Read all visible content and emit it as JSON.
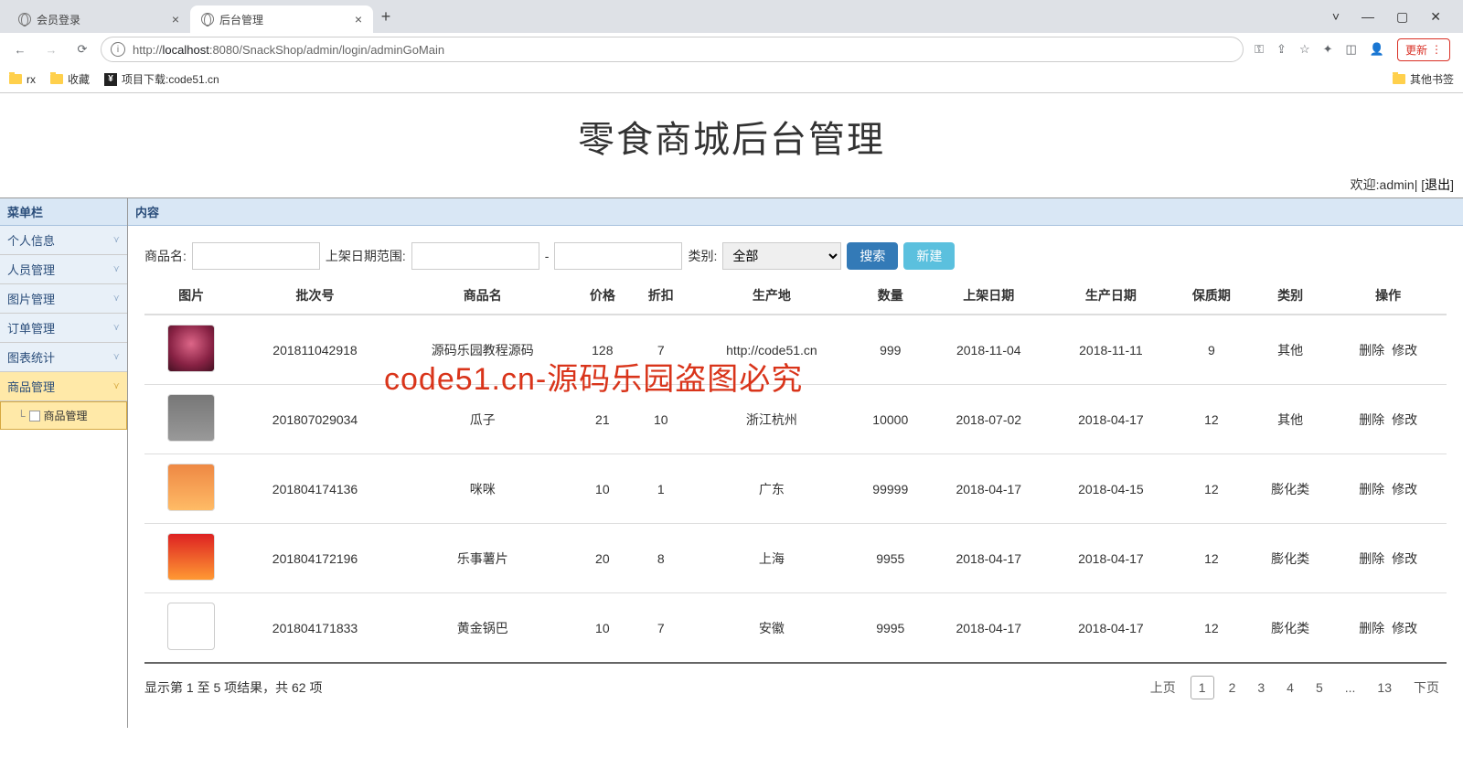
{
  "browser": {
    "tabs": [
      {
        "title": "会员登录",
        "active": false
      },
      {
        "title": "后台管理",
        "active": true
      }
    ],
    "window_controls": {
      "minimize": "—",
      "maximize": "▢",
      "close": "✕"
    },
    "url_host": "localhost",
    "url_prefix": "http://",
    "url_port_path": ":8080/SnackShop/admin/login/adminGoMain",
    "update_label": "更新",
    "bookmarks": [
      {
        "label": "rx",
        "type": "folder"
      },
      {
        "label": "收藏",
        "type": "folder"
      },
      {
        "label": "项目下载:code51.cn",
        "type": "link"
      }
    ],
    "other_bookmarks": "其他书签"
  },
  "header": {
    "title": "零食商城后台管理",
    "welcome_prefix": "欢迎:",
    "username": "admin",
    "logout_label": "退出"
  },
  "sidebar": {
    "title": "菜单栏",
    "items": [
      {
        "label": "个人信息"
      },
      {
        "label": "人员管理"
      },
      {
        "label": "图片管理"
      },
      {
        "label": "订单管理"
      },
      {
        "label": "图表统计"
      },
      {
        "label": "商品管理",
        "active": true,
        "submenu": [
          {
            "label": "商品管理"
          }
        ]
      }
    ]
  },
  "content": {
    "panel_title": "内容",
    "filters": {
      "name_label": "商品名:",
      "date_range_label": "上架日期范围:",
      "range_sep": "-",
      "category_label": "类别:",
      "category_value": "全部",
      "search_label": "搜索",
      "create_label": "新建"
    },
    "columns": [
      "图片",
      "批次号",
      "商品名",
      "价格",
      "折扣",
      "生产地",
      "数量",
      "上架日期",
      "生产日期",
      "保质期",
      "类别",
      "操作"
    ],
    "rows": [
      {
        "thumb": "t1",
        "batch": "201811042918",
        "name": "源码乐园教程源码",
        "price": "128",
        "discount": "7",
        "origin": "http://code51.cn",
        "qty": "999",
        "list_date": "2018-11-04",
        "prod_date": "2018-11-11",
        "shelf": "9",
        "cat": "其他"
      },
      {
        "thumb": "t2",
        "batch": "201807029034",
        "name": "瓜子",
        "price": "21",
        "discount": "10",
        "origin": "浙江杭州",
        "qty": "10000",
        "list_date": "2018-07-02",
        "prod_date": "2018-04-17",
        "shelf": "12",
        "cat": "其他"
      },
      {
        "thumb": "t3",
        "batch": "201804174136",
        "name": "咪咪",
        "price": "10",
        "discount": "1",
        "origin": "广东",
        "qty": "99999",
        "list_date": "2018-04-17",
        "prod_date": "2018-04-15",
        "shelf": "12",
        "cat": "膨化类"
      },
      {
        "thumb": "t4",
        "batch": "201804172196",
        "name": "乐事薯片",
        "price": "20",
        "discount": "8",
        "origin": "上海",
        "qty": "9955",
        "list_date": "2018-04-17",
        "prod_date": "2018-04-17",
        "shelf": "12",
        "cat": "膨化类"
      },
      {
        "thumb": "t5",
        "batch": "201804171833",
        "name": "黄金锅巴",
        "price": "10",
        "discount": "7",
        "origin": "安徽",
        "qty": "9995",
        "list_date": "2018-04-17",
        "prod_date": "2018-04-17",
        "shelf": "12",
        "cat": "膨化类"
      }
    ],
    "ops": {
      "delete": "删除",
      "edit": "修改"
    },
    "footer_info": "显示第 1 至 5 项结果，共 62 项",
    "pager": {
      "prev": "上页",
      "pages": [
        "1",
        "2",
        "3",
        "4",
        "5",
        "...",
        "13"
      ],
      "current": "1",
      "next": "下页"
    }
  },
  "watermark": "code51.cn-源码乐园盗图必究"
}
